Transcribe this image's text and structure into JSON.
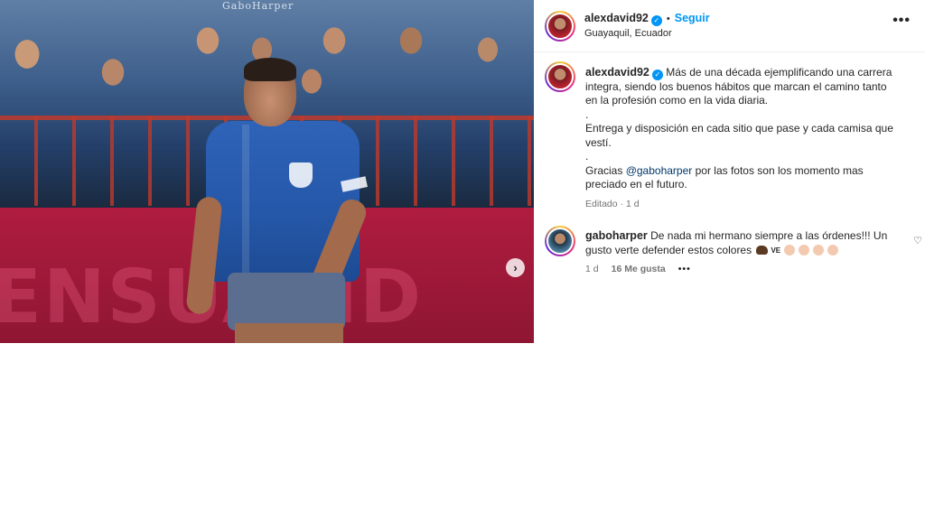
{
  "photo": {
    "watermark": "GaboHarper",
    "board_text": "ENSUALID",
    "next_arrow": "›"
  },
  "header": {
    "username": "alexdavid92",
    "verified_mark": "✓",
    "separator": "•",
    "follow_label": "Seguir",
    "location": "Guayaquil, Ecuador",
    "more_label": "•••"
  },
  "caption": {
    "username": "alexdavid92",
    "verified_mark": "✓",
    "line1": "Más de una década ejemplificando una carrera integra, siendo los buenos hábitos que marcan el camino tanto en la profesión como en la vida diaria.",
    "dot1": ".",
    "line2": "Entrega y disposición en cada sitio que pase y cada camisa que vestí.",
    "dot2": ".",
    "line3_prefix": "Gracias ",
    "mention": "@gaboharper",
    "line3_suffix": " por las fotos son los momento mas preciado en el futuro.",
    "meta": "Editado · 1 d"
  },
  "comment": {
    "username": "gaboharper",
    "text": "De nada mi hermano siempre a las órdenes!!! Un gusto verte defender estos colores",
    "ve_badge": "VE",
    "time": "1 d",
    "likes": "16 Me gusta",
    "options": "•••",
    "heart": "♡"
  },
  "colors": {
    "accent_blue": "#0095f6",
    "mention_blue": "#00376b",
    "meta_gray": "#737373",
    "text": "#262626"
  },
  "icons": [
    "verified-badge-icon",
    "more-options-icon",
    "next-arrow-icon",
    "heart-icon",
    "bison-emoji",
    "clap-emoji"
  ]
}
